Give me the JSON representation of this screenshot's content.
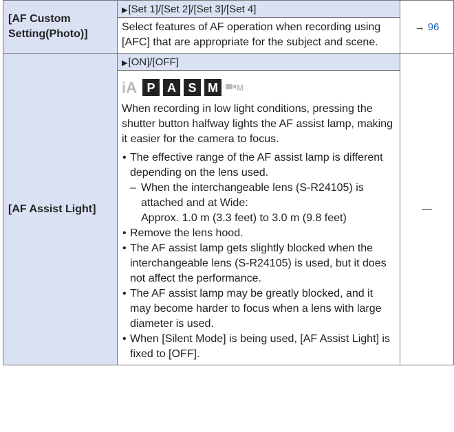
{
  "rows": [
    {
      "name": "[AF Custom Setting(Photo)]",
      "options": "[Set 1]/[Set 2]/[Set 3]/[Set 4]",
      "description": "Select features of AF operation when recording using [AFC] that are appropriate for the subject and scene.",
      "ref_arrow": "→",
      "ref_page": "96"
    },
    {
      "name": "[AF Assist Light]",
      "options": "[ON]/[OFF]",
      "modes": {
        "ia": "iA",
        "p": "P",
        "a": "A",
        "s": "S",
        "m": "M",
        "movie": "M"
      },
      "description": "When recording in low light conditions, pressing the shutter button halfway lights the AF assist lamp, making it easier for the camera to focus.",
      "notes": [
        "The effective range of the AF assist lamp is different depending on the lens used.",
        "Remove the lens hood.",
        "The AF assist lamp gets slightly blocked when the interchangeable lens (S-R24105) is used, but it does not affect the performance.",
        "The AF assist lamp may be greatly blocked, and it may become harder to focus when a lens with large diameter is used.",
        "When [Silent Mode] is being used, [AF Assist Light] is fixed to [OFF]."
      ],
      "subnote": "When the interchangeable lens (S-R24105) is attached and at Wide:",
      "subnote_range": "Approx. 1.0 m (3.3 feet) to 3.0 m (9.8 feet)",
      "subnote_dash": "–",
      "ref": "—"
    }
  ],
  "colors": {
    "header_bg": "#d9e1f3",
    "link": "#1560bd",
    "mode_box": "#222222",
    "mode_disabled": "#b9b9b9"
  },
  "icons": {
    "option_marker": "right-triangle-icon",
    "movie_mode": "creative-video-icon"
  }
}
